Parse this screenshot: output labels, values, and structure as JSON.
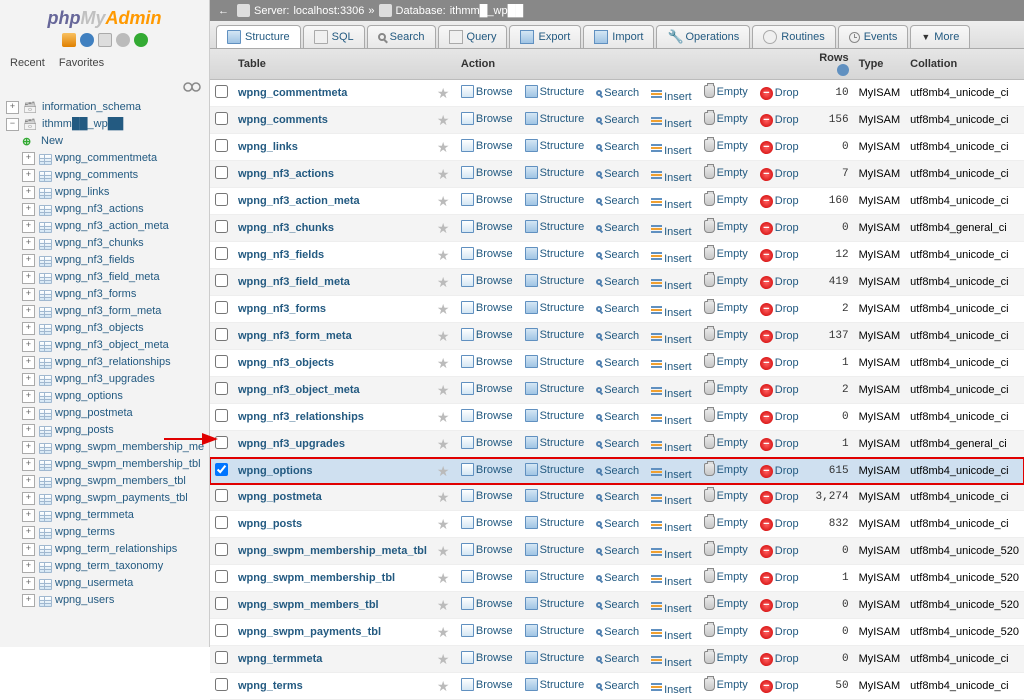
{
  "logo": {
    "php": "php",
    "my": "My",
    "admin": "Admin"
  },
  "recent_fav": {
    "recent": "Recent",
    "favorites": "Favorites"
  },
  "breadcrumb": {
    "server_label": "Server:",
    "server_value": "localhost:3306",
    "db_label": "Database:",
    "db_value": "ithmm█_wp██"
  },
  "tabs": {
    "structure": "Structure",
    "sql": "SQL",
    "search": "Search",
    "query": "Query",
    "export": "Export",
    "import": "Import",
    "operations": "Operations",
    "routines": "Routines",
    "events": "Events",
    "more": "More"
  },
  "table_headers": {
    "table": "Table",
    "action": "Action",
    "rows": "Rows",
    "type": "Type",
    "collation": "Collation"
  },
  "actions": {
    "browse": "Browse",
    "structure": "Structure",
    "search": "Search",
    "insert": "Insert",
    "empty": "Empty",
    "drop": "Drop"
  },
  "sidebar": {
    "info_schema": "information_schema",
    "current_db": "ithmm██_wp██",
    "new": "New",
    "tables": [
      "wpng_commentmeta",
      "wpng_comments",
      "wpng_links",
      "wpng_nf3_actions",
      "wpng_nf3_action_meta",
      "wpng_nf3_chunks",
      "wpng_nf3_fields",
      "wpng_nf3_field_meta",
      "wpng_nf3_forms",
      "wpng_nf3_form_meta",
      "wpng_nf3_objects",
      "wpng_nf3_object_meta",
      "wpng_nf3_relationships",
      "wpng_nf3_upgrades",
      "wpng_options",
      "wpng_postmeta",
      "wpng_posts",
      "wpng_swpm_membership_me",
      "wpng_swpm_membership_tbl",
      "wpng_swpm_members_tbl",
      "wpng_swpm_payments_tbl",
      "wpng_termmeta",
      "wpng_terms",
      "wpng_term_relationships",
      "wpng_term_taxonomy",
      "wpng_usermeta",
      "wpng_users"
    ]
  },
  "tables": [
    {
      "name": "wpng_commentmeta",
      "rows": "10",
      "type": "MyISAM",
      "collation": "utf8mb4_unicode_ci"
    },
    {
      "name": "wpng_comments",
      "rows": "156",
      "type": "MyISAM",
      "collation": "utf8mb4_unicode_ci"
    },
    {
      "name": "wpng_links",
      "rows": "0",
      "type": "MyISAM",
      "collation": "utf8mb4_unicode_ci"
    },
    {
      "name": "wpng_nf3_actions",
      "rows": "7",
      "type": "MyISAM",
      "collation": "utf8mb4_unicode_ci"
    },
    {
      "name": "wpng_nf3_action_meta",
      "rows": "160",
      "type": "MyISAM",
      "collation": "utf8mb4_unicode_ci"
    },
    {
      "name": "wpng_nf3_chunks",
      "rows": "0",
      "type": "MyISAM",
      "collation": "utf8mb4_general_ci"
    },
    {
      "name": "wpng_nf3_fields",
      "rows": "12",
      "type": "MyISAM",
      "collation": "utf8mb4_unicode_ci"
    },
    {
      "name": "wpng_nf3_field_meta",
      "rows": "419",
      "type": "MyISAM",
      "collation": "utf8mb4_unicode_ci"
    },
    {
      "name": "wpng_nf3_forms",
      "rows": "2",
      "type": "MyISAM",
      "collation": "utf8mb4_unicode_ci"
    },
    {
      "name": "wpng_nf3_form_meta",
      "rows": "137",
      "type": "MyISAM",
      "collation": "utf8mb4_unicode_ci"
    },
    {
      "name": "wpng_nf3_objects",
      "rows": "1",
      "type": "MyISAM",
      "collation": "utf8mb4_unicode_ci"
    },
    {
      "name": "wpng_nf3_object_meta",
      "rows": "2",
      "type": "MyISAM",
      "collation": "utf8mb4_unicode_ci"
    },
    {
      "name": "wpng_nf3_relationships",
      "rows": "0",
      "type": "MyISAM",
      "collation": "utf8mb4_unicode_ci"
    },
    {
      "name": "wpng_nf3_upgrades",
      "rows": "1",
      "type": "MyISAM",
      "collation": "utf8mb4_general_ci"
    },
    {
      "name": "wpng_options",
      "rows": "615",
      "type": "MyISAM",
      "collation": "utf8mb4_unicode_ci",
      "highlighted": true,
      "checked": true
    },
    {
      "name": "wpng_postmeta",
      "rows": "3,274",
      "type": "MyISAM",
      "collation": "utf8mb4_unicode_ci"
    },
    {
      "name": "wpng_posts",
      "rows": "832",
      "type": "MyISAM",
      "collation": "utf8mb4_unicode_ci"
    },
    {
      "name": "wpng_swpm_membership_meta_tbl",
      "rows": "0",
      "type": "MyISAM",
      "collation": "utf8mb4_unicode_520"
    },
    {
      "name": "wpng_swpm_membership_tbl",
      "rows": "1",
      "type": "MyISAM",
      "collation": "utf8mb4_unicode_520"
    },
    {
      "name": "wpng_swpm_members_tbl",
      "rows": "0",
      "type": "MyISAM",
      "collation": "utf8mb4_unicode_520"
    },
    {
      "name": "wpng_swpm_payments_tbl",
      "rows": "0",
      "type": "MyISAM",
      "collation": "utf8mb4_unicode_520"
    },
    {
      "name": "wpng_termmeta",
      "rows": "0",
      "type": "MyISAM",
      "collation": "utf8mb4_unicode_ci"
    },
    {
      "name": "wpng_terms",
      "rows": "50",
      "type": "MyISAM",
      "collation": "utf8mb4_unicode_ci"
    }
  ]
}
